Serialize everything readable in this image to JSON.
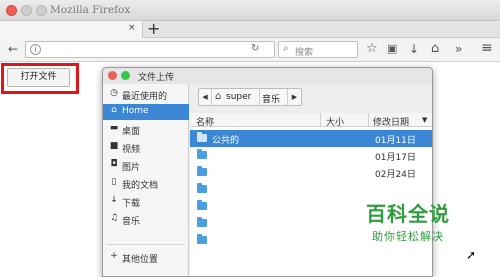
{
  "browser": {
    "window_title": "Mozilla Firefox",
    "tab_close": "×",
    "new_tab": "+",
    "search_placeholder": "搜索",
    "icons": {
      "back": "←",
      "info": "i",
      "reload": "↻",
      "search": "⌕",
      "star": "☆",
      "reader": "▣",
      "download": "↓",
      "home": "⌂",
      "overflow": "»",
      "menu": "≡"
    }
  },
  "page": {
    "open_file_button": "打开文件"
  },
  "dialog": {
    "title": "文件上传",
    "sidebar": [
      {
        "icon": "◷",
        "label": "最近使用的"
      },
      {
        "icon": "⌂",
        "label": "Home"
      },
      {
        "icon": "▬",
        "label": "桌面"
      },
      {
        "icon": "■",
        "label": "视频"
      },
      {
        "icon": "◘",
        "label": "图片"
      },
      {
        "icon": "▯",
        "label": "我的文档"
      },
      {
        "icon": "↓",
        "label": "下载"
      },
      {
        "icon": "♫",
        "label": "音乐"
      },
      {
        "icon": "+",
        "label": "其他位置"
      }
    ],
    "path": {
      "left": "◀",
      "home_icon": "⌂",
      "user": "super",
      "folder": "音乐",
      "right": "▶"
    },
    "columns": {
      "name": "名称",
      "size": "大小",
      "modified": "修改日期",
      "sort_icon": "▼"
    },
    "files": [
      {
        "name": "公共的",
        "date": "01月11日",
        "selected": true
      },
      {
        "name": "",
        "date": "01月17日",
        "selected": false
      },
      {
        "name": "",
        "date": "02月24日",
        "selected": false
      },
      {
        "name": "",
        "date": "",
        "selected": false
      },
      {
        "name": "",
        "date": "",
        "selected": false
      },
      {
        "name": "",
        "date": "",
        "selected": false
      },
      {
        "name": "",
        "date": "",
        "selected": false
      }
    ]
  },
  "watermark": {
    "title": "百科全说",
    "subtitle": "助你轻松解决"
  }
}
